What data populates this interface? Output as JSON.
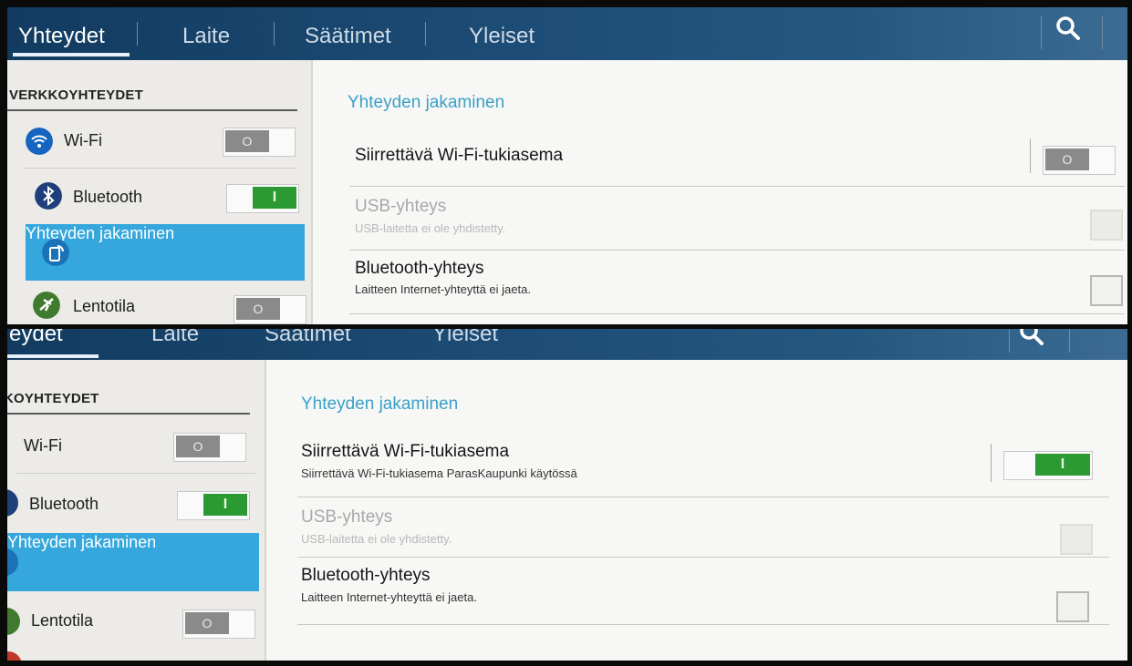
{
  "tabs": [
    {
      "label": "Yhteydet"
    },
    {
      "label": "Laite"
    },
    {
      "label": "Säätimet"
    },
    {
      "label": "Yleiset"
    }
  ],
  "bottom_tab_fragments": [
    "eydet",
    "Laite",
    "Säätimet",
    "Yleiset"
  ],
  "sidebar": {
    "section_title": "VERKKOYHTEYDET",
    "section_title_fragment": "KOYHTEYDET",
    "items": [
      {
        "label": "Wi-Fi",
        "icon": "wifi-icon",
        "toggle": "off"
      },
      {
        "label": "Bluetooth",
        "icon": "bluetooth-icon",
        "toggle": "on"
      },
      {
        "label": "Yhteyden jakaminen",
        "icon": "tethering-icon",
        "selected": true
      },
      {
        "label": "Lentotila",
        "icon": "airplane-icon",
        "toggle": "off"
      }
    ]
  },
  "main": {
    "title": "Yhteyden jakaminen",
    "top": {
      "hotspot_title": "Siirrettävä Wi-Fi-tukiasema",
      "hotspot_toggle": "off",
      "usb_title": "USB-yhteys",
      "usb_sub": "USB-laitetta ei ole yhdistetty.",
      "bt_title": "Bluetooth-yhteys",
      "bt_sub": "Laitteen Internet-yhteyttä ei jaeta."
    },
    "bottom": {
      "hotspot_title": "Siirrettävä Wi-Fi-tukiasema",
      "hotspot_sub": "Siirrettävä Wi-Fi-tukiasema ParasKaupunki käytössä",
      "hotspot_toggle": "on",
      "usb_title": "USB-yhteys",
      "usb_sub": "USB-laitetta ei ole yhdistetty.",
      "bt_title": "Bluetooth-yhteys",
      "bt_sub": "Laitteen Internet-yhteyttä ei jaeta."
    }
  },
  "glyphs": {
    "toggle_off": "O",
    "toggle_on": "I"
  },
  "colors": {
    "accent": "#35a7dc",
    "toggle_on": "#2c9a32",
    "title_blue": "#3aa0c8",
    "tabbar": "#1e4e78"
  }
}
